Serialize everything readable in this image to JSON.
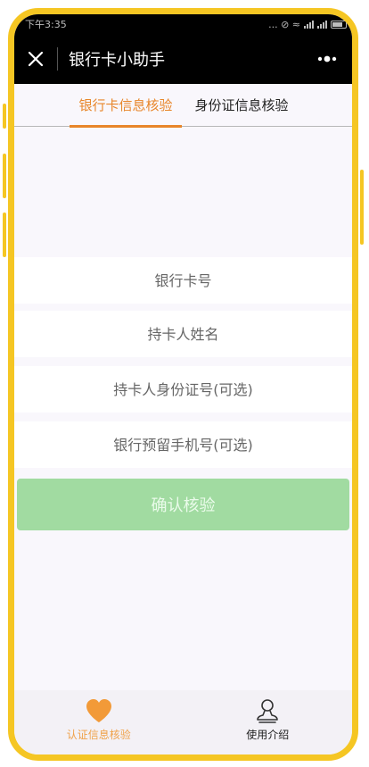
{
  "status_bar": {
    "time": "下午3:35",
    "indicators": "... ⊘ ≈"
  },
  "nav": {
    "title": "银行卡小助手",
    "close_icon": "close-icon",
    "more_icon": "more-dots-icon"
  },
  "tabs": [
    {
      "label": "银行卡信息核验",
      "active": true
    },
    {
      "label": "身份证信息核验",
      "active": false
    }
  ],
  "form": {
    "card_number_placeholder": "银行卡号",
    "holder_name_placeholder": "持卡人姓名",
    "holder_id_placeholder": "持卡人身份证号(可选)",
    "phone_placeholder": "银行预留手机号(可选)",
    "confirm_label": "确认核验"
  },
  "bottom_nav": [
    {
      "label": "认证信息核验",
      "icon": "heart-icon",
      "active": true
    },
    {
      "label": "使用介绍",
      "icon": "user-icon",
      "active": false
    }
  ],
  "colors": {
    "accent": "#e8862a",
    "frame": "#f5c623",
    "confirm_button": "#a1dba1",
    "nav_bar": "#000000"
  }
}
